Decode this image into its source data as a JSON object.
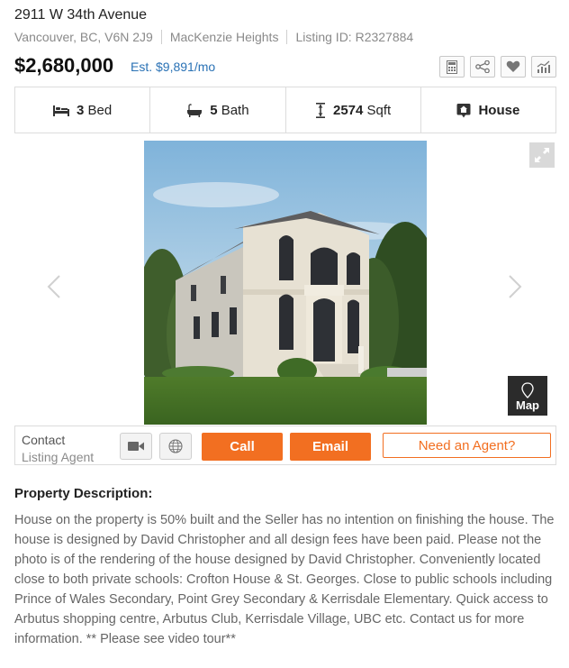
{
  "listing": {
    "address": "2911 W 34th Avenue",
    "city": "Vancouver, BC, V6N 2J9",
    "neighborhood": "MacKenzie Heights",
    "listing_id": "Listing ID: R2327884",
    "price": "$2,680,000",
    "est_payment": "Est. $9,891/mo"
  },
  "tools": [
    {
      "icon": "calculator-icon"
    },
    {
      "icon": "share-icon"
    },
    {
      "icon": "heart-icon"
    },
    {
      "icon": "stats-chart-icon"
    }
  ],
  "facts": {
    "beds_value": "3",
    "beds_label": "Bed",
    "baths_value": "5",
    "baths_label": "Bath",
    "sqft_value": "2574",
    "sqft_label": "Sqft",
    "type_label": "House"
  },
  "gallery": {
    "map_label": "Map"
  },
  "contact": {
    "line1": "Contact",
    "line2": "Listing Agent",
    "call_label": "Call",
    "email_label": "Email",
    "need_agent_label": "Need an Agent?"
  },
  "description": {
    "title": "Property Description:",
    "body": "House on the property is 50% built and the Seller has no intention on finishing the house. The house is designed by David Christopher and all design fees have been paid. Please not the photo is of the rendering of the house designed by David Christopher. Conveniently located close to both private schools: Crofton House & St. Georges. Close to public schools including Prince of Wales Secondary, Point Grey Secondary & Kerrisdale Elementary. Quick access to Arbutus shopping centre, Arbutus Club, Kerrisdale Village, UBC etc. Contact us for more information. ** Please see video tour**"
  },
  "colors": {
    "accent": "#f26f21",
    "link": "#2a72b5"
  }
}
